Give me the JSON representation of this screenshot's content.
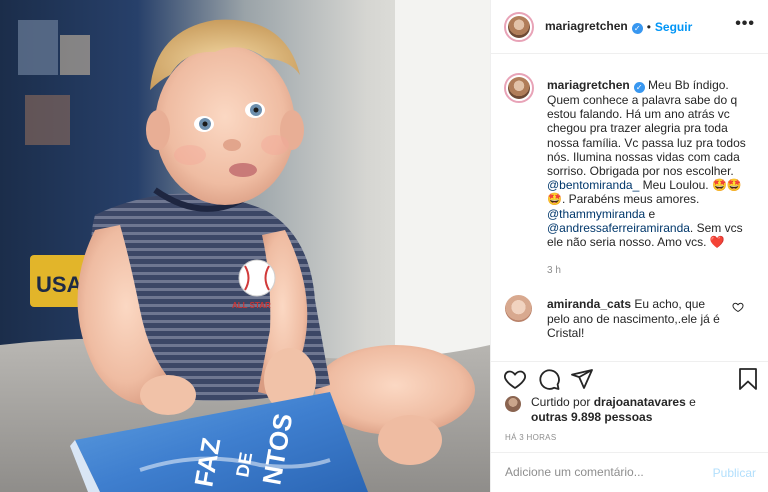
{
  "header": {
    "username": "mariagretchen",
    "separator": "•",
    "follow_label": "Seguir",
    "more_label": "•••",
    "verified_glyph": "✓"
  },
  "caption": {
    "username": "mariagretchen",
    "text_1": " Meu Bb índigo. Quem conhece a palavra sabe do q estou falando. Há um ano atrás vc chegou pra trazer alegria pra toda nossa família. Vc passa luz pra todos nós. Ilumina nossas vidas com cada sorriso. Obrigada por nos escolher. ",
    "mention_1": "@bentomiranda_",
    "text_2": " Meu Loulou. 🤩🤩🤩. Parabéns meus amores. ",
    "mention_2": "@thammymiranda",
    "text_3": " e ",
    "mention_3": "@andressaferreiramiranda",
    "text_4": ". Sem vcs ele não seria nosso. Amo vcs. ❤️",
    "time": "3 h"
  },
  "comment": {
    "username": "amiranda_cats",
    "text": " Eu acho, que pelo ano de nascimento,.ele já é Cristal!"
  },
  "likes": {
    "prefix": "Curtido por ",
    "user": "drajoanatavares",
    "middle": " e ",
    "others": "outras 9.898 pessoas"
  },
  "age": "HÁ 3 HORAS",
  "add_comment": {
    "placeholder": "Adicione um comentário...",
    "post_label": "Publicar"
  },
  "photo": {
    "book_title": "FAZ DE\nCONTOS",
    "bodysuit_text": "ALL STAR",
    "tag_text": "USA"
  },
  "colors": {
    "link": "#0095f6",
    "mention": "#00376b",
    "muted": "#8e8e8e",
    "text": "#262626",
    "border": "#efefef",
    "verified": "#3897f0"
  },
  "icons": [
    "heart-icon",
    "comment-icon",
    "share-icon",
    "bookmark-icon",
    "more-icon",
    "verified-icon"
  ]
}
